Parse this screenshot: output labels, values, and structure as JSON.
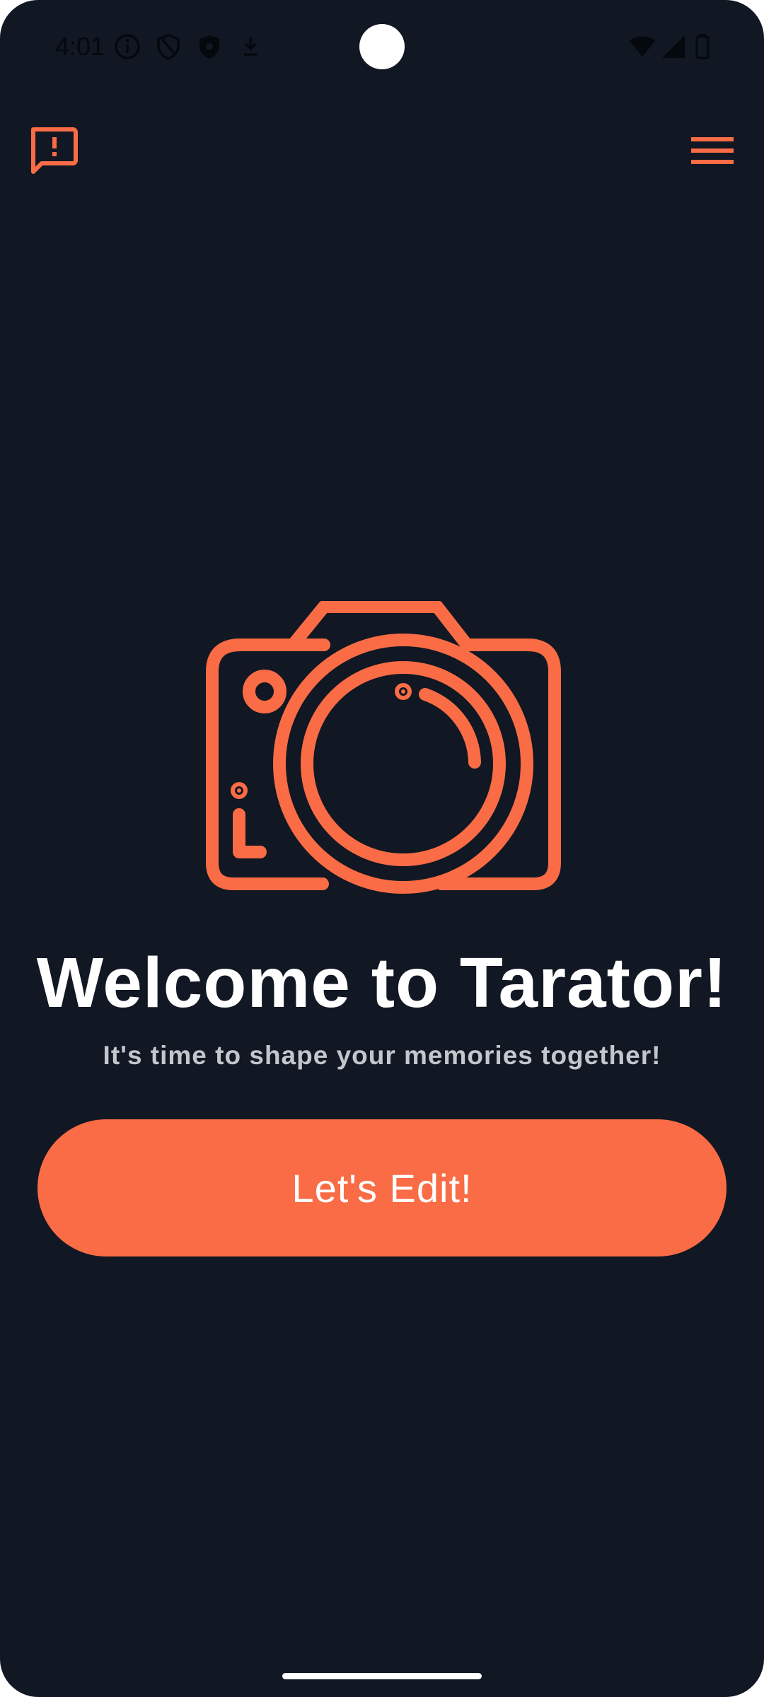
{
  "status_bar": {
    "time": "4:01",
    "icons": [
      "info-icon",
      "shield-icon",
      "vpn-shield-icon",
      "download-icon",
      "wifi-icon",
      "signal-icon",
      "battery-icon"
    ]
  },
  "top_bar": {
    "left_icon": "feedback-icon",
    "right_icon": "menu-icon"
  },
  "main": {
    "illustration": "camera-icon",
    "title": "Welcome to Tarator!",
    "subtitle": "It's time to shape your memories together!",
    "cta_label": "Let's Edit!"
  },
  "colors": {
    "background": "#111723",
    "accent": "#fa6c45",
    "title": "#ffffff",
    "subtitle": "#c4c6cc"
  }
}
